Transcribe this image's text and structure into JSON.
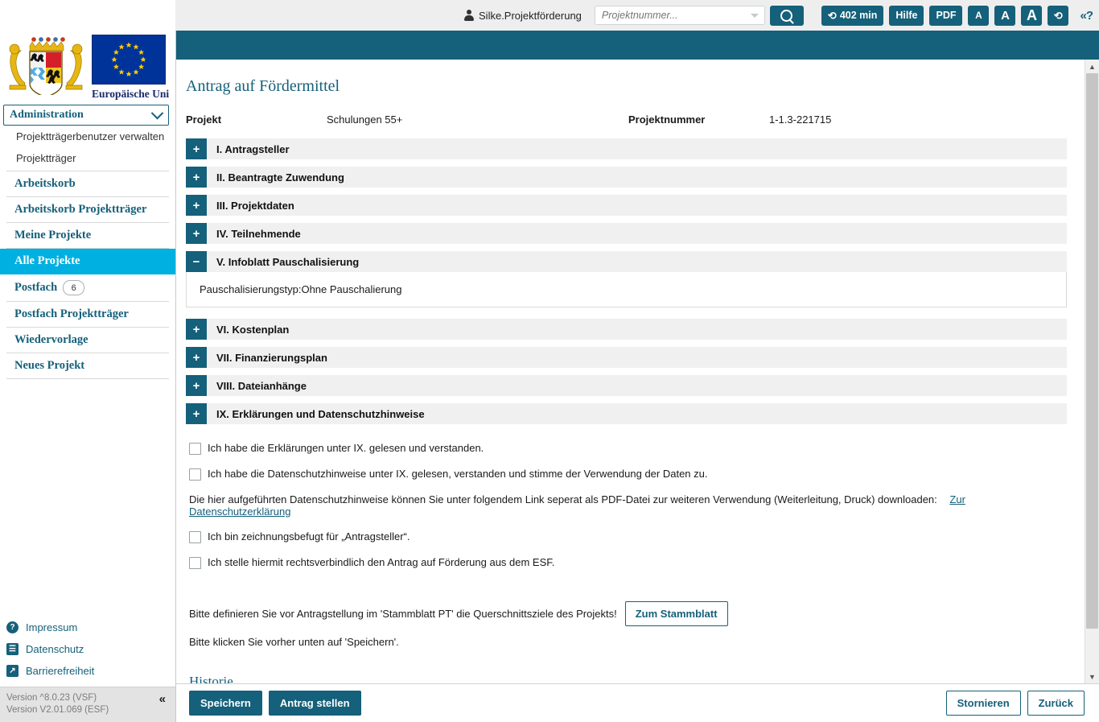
{
  "topbar": {
    "user_icon": "user-icon",
    "username": "Silke.Projektförderung",
    "search_placeholder": "Projektnummer...",
    "search_value": "",
    "search_icon": "search-icon",
    "session_timer": "402 min",
    "session_icon": "refresh-icon",
    "help_label": "Hilfe",
    "pdf_label": "PDF",
    "font_small": "A",
    "font_medium": "A",
    "font_large": "A",
    "reload_icon": "refresh-icon",
    "help_toggle": "«?"
  },
  "sidebar": {
    "logo_coat_alt": "bayern-coat-of-arms",
    "logo_eu_alt": "european-union-flag",
    "eu_label": "Europäische Uni",
    "dropdown": {
      "selected": "Administration",
      "options": [
        "Administration"
      ]
    },
    "sub_items": [
      {
        "label": "Projektträgerbenutzer verwalten"
      },
      {
        "label": "Projektträger"
      }
    ],
    "nav_items": [
      {
        "label": "Arbeitskorb",
        "active": false,
        "badge": ""
      },
      {
        "label": "Arbeitskorb Projektträger",
        "active": false,
        "badge": ""
      },
      {
        "label": "Meine Projekte",
        "active": false,
        "badge": ""
      },
      {
        "label": "Alle Projekte",
        "active": true,
        "badge": ""
      },
      {
        "label": "Postfach",
        "active": false,
        "badge": "6"
      },
      {
        "label": "Postfach Projektträger",
        "active": false,
        "badge": ""
      },
      {
        "label": "Wiedervorlage",
        "active": false,
        "badge": ""
      },
      {
        "label": "Neues Projekt",
        "active": false,
        "badge": ""
      }
    ],
    "footer_links": [
      {
        "label": "Impressum",
        "icon": "question-circle-icon",
        "glyph": "?"
      },
      {
        "label": "Datenschutz",
        "icon": "document-lock-icon",
        "glyph": "☰"
      },
      {
        "label": "Barrierefreiheit",
        "icon": "external-link-icon",
        "glyph": "↗"
      }
    ],
    "version_line1": "Version ^8.0.23 (VSF)",
    "version_line2": "Version V2.01.069 (ESF)",
    "collapse_icon": "«"
  },
  "main": {
    "page_title": "Antrag auf Fördermittel",
    "meta": {
      "projekt_label": "Projekt",
      "projekt_value": "Schulungen 55+",
      "projektnummer_label": "Projektnummer",
      "projektnummer_value": "1-1.3-221715"
    },
    "sections": [
      {
        "title": "I. Antragsteller",
        "toggle": "+",
        "expanded": false
      },
      {
        "title": "II. Beantragte Zuwendung",
        "toggle": "+",
        "expanded": false
      },
      {
        "title": "III. Projektdaten",
        "toggle": "+",
        "expanded": false
      },
      {
        "title": "IV. Teilnehmende",
        "toggle": "+",
        "expanded": false
      },
      {
        "title": "V. Infoblatt Pauschalisierung",
        "toggle": "−",
        "expanded": true,
        "body": "Pauschalisierungstyp:Ohne Pauschalierung"
      },
      {
        "title": "VI. Kostenplan",
        "toggle": "+",
        "expanded": false
      },
      {
        "title": "VII. Finanzierungsplan",
        "toggle": "+",
        "expanded": false
      },
      {
        "title": "VIII. Dateianhänge",
        "toggle": "+",
        "expanded": false
      },
      {
        "title": "IX. Erklärungen und Datenschutzhinweise",
        "toggle": "+",
        "expanded": false
      }
    ],
    "checkboxes": [
      {
        "label": "Ich habe die Erklärungen unter IX. gelesen und verstanden.",
        "checked": false
      },
      {
        "label": "Ich habe die Datenschutzhinweise unter IX. gelesen, verstanden und stimme der Verwendung der Daten zu.",
        "checked": false
      }
    ],
    "privacy_text": "Die hier aufgeführten Datenschutzhinweise können Sie unter folgendem Link seperat als PDF-Datei zur weiteren Verwendung (Weiterleitung, Druck) downloaden:",
    "privacy_link": "Zur Datenschutzerklärung",
    "checkboxes2": [
      {
        "label": "Ich bin zeichnungsbefugt für „Antragsteller“.",
        "checked": false
      },
      {
        "label": "Ich stelle hiermit rechtsverbindlich den Antrag auf Förderung aus dem ESF.",
        "checked": false
      }
    ],
    "note_text": "Bitte definieren Sie vor Antragstellung im 'Stammblatt PT' die Querschnittsziele des Projekts!",
    "stammblatt_button": "Zum Stammblatt",
    "note_text2": "Bitte klicken Sie vorher unten auf 'Speichern'.",
    "historie_heading": "Historie"
  },
  "footer": {
    "save_label": "Speichern",
    "submit_label": "Antrag stellen",
    "cancel_label": "Stornieren",
    "back_label": "Zurück"
  },
  "colors": {
    "teal": "#15607a",
    "cyan_active": "#00b0e0",
    "section_bg": "#f0f0f0",
    "topbar_bg": "#eeeeee"
  }
}
